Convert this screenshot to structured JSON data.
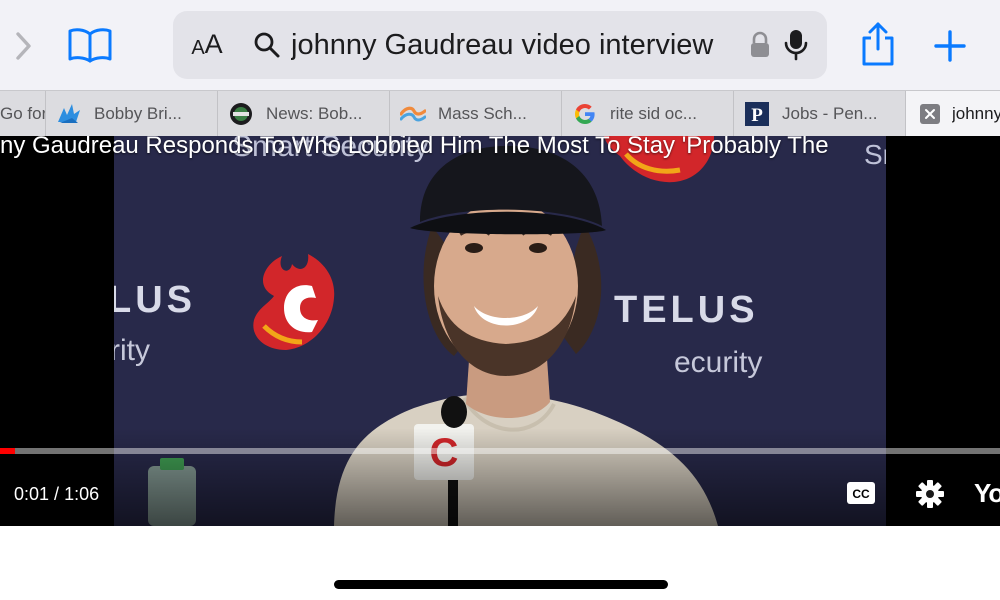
{
  "toolbar": {
    "forward_icon": "chevron-right-icon",
    "bookmarks_icon": "book-icon",
    "share_icon": "share-icon",
    "new_tab_icon": "plus-icon",
    "accent_color": "#0a7aff"
  },
  "address_bar": {
    "aa_small": "A",
    "aa_large": "A",
    "query": "johnny Gaudreau video interview",
    "search_icon": "magnifier-icon",
    "lock_icon": "lock-icon",
    "mic_icon": "microphone-icon"
  },
  "tabs": [
    {
      "title": "Go for",
      "icon": "none"
    },
    {
      "title": "Bobby Bri...",
      "icon": "blue-bird-icon"
    },
    {
      "title": "News: Bob...",
      "icon": "round-logo-icon"
    },
    {
      "title": "Mass Sch...",
      "icon": "wave-icon"
    },
    {
      "title": "rite sid oc...",
      "icon": "google-icon"
    },
    {
      "title": "Jobs - Pen...",
      "icon": "p-logo-icon"
    },
    {
      "title": "johnny",
      "icon": "close-icon",
      "active": true
    }
  ],
  "video": {
    "title": "ny Gaudreau Responds To Who Lobbied Him The Most To Stay 'Probably The",
    "current_time": "0:01",
    "duration": "1:06",
    "time_separator": " / ",
    "progress_fraction": 0.015,
    "cc_label": "CC",
    "logo_text": "Yo",
    "backdrop_text": {
      "smart_security_top": "Smart Security",
      "sm_right": "Sr",
      "telus_left": "LUS",
      "telus_right": "TELUS",
      "security_left": "rity",
      "security_right": "ecurity",
      "mic_flag_letter": "C"
    },
    "flames_color": "#d2262a",
    "flames_accent": "#f2a618",
    "backdrop_color": "#28294a"
  }
}
